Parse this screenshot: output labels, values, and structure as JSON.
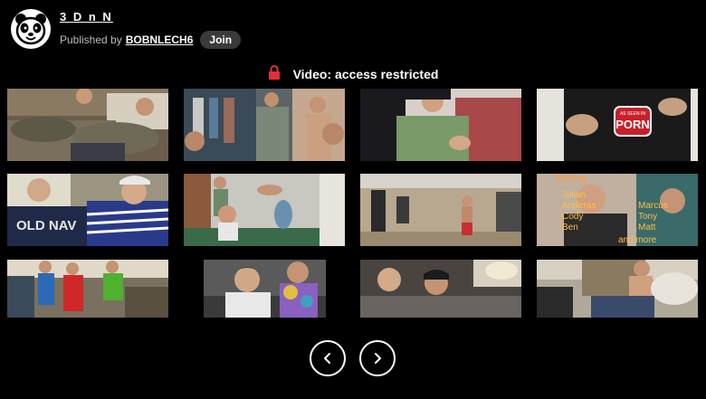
{
  "header": {
    "title": "3 D n N",
    "published_by_label": "Published by",
    "author": "BOBNLECH6",
    "join_label": "Join",
    "logo_icon": "panda-icon"
  },
  "notice": {
    "icon": "lock-icon",
    "text": "Video: access restricted",
    "lock_color": "#e0303c"
  },
  "thumb4": {
    "badge": "AS SEEN IN PORN",
    "badge_small": "AS SEEN IN",
    "badge_big": "PORN"
  },
  "thumb5": {
    "shirt_text": "OLD NAV"
  },
  "thumb8": {
    "starring": "Starring",
    "names_left": [
      "Julian",
      "Anderas",
      "Cody",
      "Ben"
    ],
    "names_right": [
      "Marcus",
      "Tony",
      "Matt",
      "and more"
    ]
  },
  "pager": {
    "prev_icon": "chevron-left-icon",
    "next_icon": "chevron-right-icon"
  }
}
